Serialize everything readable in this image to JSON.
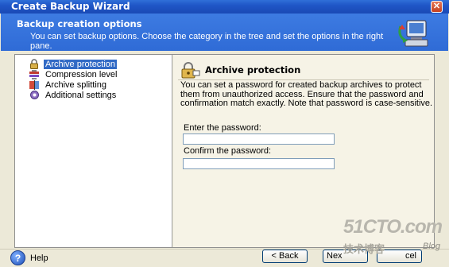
{
  "window": {
    "title": "Create Backup Wizard"
  },
  "header": {
    "title": "Backup creation options",
    "description": "You can set backup options. Choose the category in the tree and set the options in the right pane."
  },
  "tree": {
    "items": [
      {
        "label": "Archive protection",
        "icon": "lock-icon",
        "selected": true
      },
      {
        "label": "Compression level",
        "icon": "compression-icon",
        "selected": false
      },
      {
        "label": "Archive splitting",
        "icon": "splitting-icon",
        "selected": false
      },
      {
        "label": "Additional settings",
        "icon": "settings-icon",
        "selected": false
      }
    ]
  },
  "pane": {
    "title": "Archive protection",
    "description": "You can set a password for created backup archives to protect them from unauthorized access. Ensure that the password and confirmation match exactly. Note that password is case-sensitive.",
    "password_label": "Enter the password:",
    "password_value": "",
    "confirm_label": "Confirm the password:",
    "confirm_value": ""
  },
  "footer": {
    "help_label": "Help",
    "back_label": "< Back",
    "next_label": "Nex",
    "cancel_label": "cel"
  },
  "watermark": {
    "main": "51CTO.com",
    "sub": "技术博客",
    "blog": "Blog"
  },
  "colors": {
    "title_bar": "#1f56c6",
    "header_band": "#3d7be2",
    "selection": "#316ac5"
  }
}
